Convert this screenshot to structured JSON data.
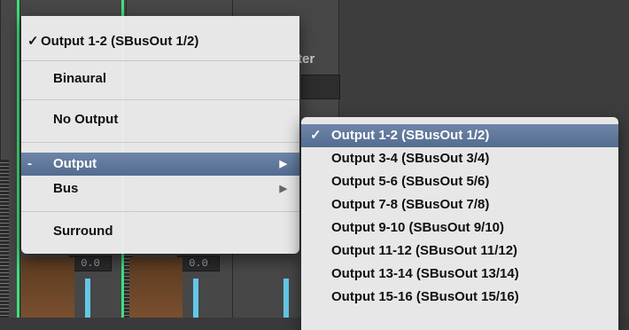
{
  "background": {
    "mixer_label": "ter",
    "fader_values": [
      "0.0",
      "0.0"
    ]
  },
  "main_menu": {
    "items": [
      {
        "check": "✓",
        "label": "Output 1-2  (SBusOut 1/2)"
      },
      {
        "label": "Binaural"
      },
      {
        "label": "No Output"
      },
      {
        "check": "-",
        "label": "Output",
        "arrow": "▶",
        "highlighted": true
      },
      {
        "label": "Bus",
        "arrow": "▶"
      },
      {
        "label": "Surround"
      }
    ]
  },
  "sub_menu": {
    "items": [
      {
        "check": "✓",
        "label": "Output 1-2  (SBusOut 1/2)",
        "highlighted": true
      },
      {
        "label": "Output 3-4  (SBusOut 3/4)"
      },
      {
        "label": "Output 5-6  (SBusOut 5/6)"
      },
      {
        "label": "Output 7-8  (SBusOut 7/8)"
      },
      {
        "label": "Output 9-10  (SBusOut 9/10)"
      },
      {
        "label": "Output 11-12  (SBusOut 11/12)"
      },
      {
        "label": "Output 13-14  (SBusOut 13/14)"
      },
      {
        "label": "Output 15-16  (SBusOut 15/16)"
      }
    ]
  }
}
